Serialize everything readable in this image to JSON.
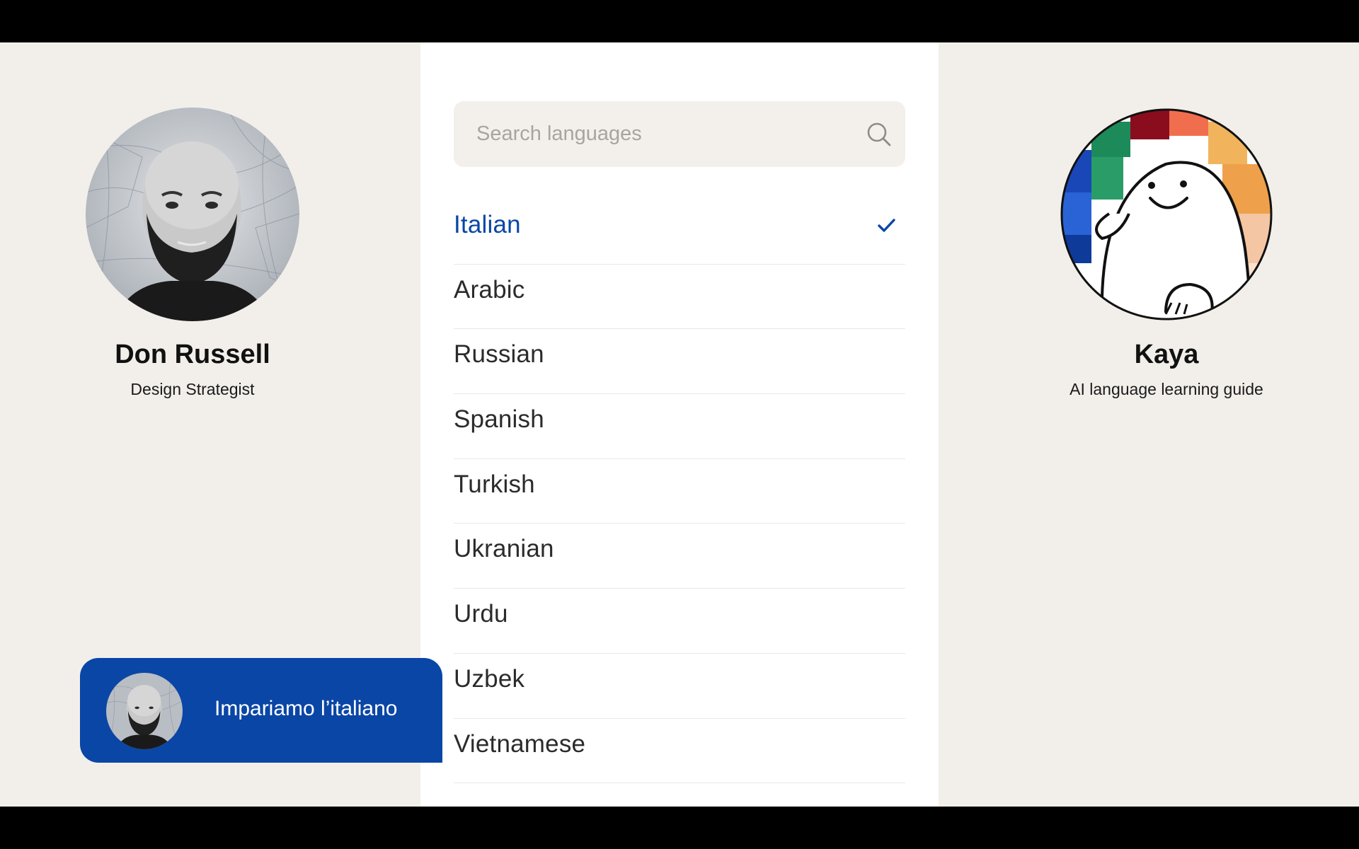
{
  "user": {
    "name": "Don Russell",
    "role": "Design Strategist"
  },
  "guide": {
    "name": "Kaya",
    "role": "AI language learning guide"
  },
  "search": {
    "placeholder": "Search languages",
    "value": ""
  },
  "languages": {
    "selected": "Italian",
    "items": [
      {
        "label": "Italian",
        "selected": true
      },
      {
        "label": "Arabic",
        "selected": false
      },
      {
        "label": "Russian",
        "selected": false
      },
      {
        "label": "Spanish",
        "selected": false
      },
      {
        "label": "Turkish",
        "selected": false
      },
      {
        "label": "Ukranian",
        "selected": false
      },
      {
        "label": "Urdu",
        "selected": false
      },
      {
        "label": "Uzbek",
        "selected": false
      },
      {
        "label": "Vietnamese",
        "selected": false
      }
    ]
  },
  "message": {
    "text": "Impariamo l’italiano"
  },
  "icons": {
    "search": "search-icon",
    "selected_check": "check-icon"
  },
  "colors": {
    "accent": "#0a46a6",
    "background": "#f2efeb",
    "panel": "#ffffff",
    "search_bg": "#f3f0ec"
  }
}
